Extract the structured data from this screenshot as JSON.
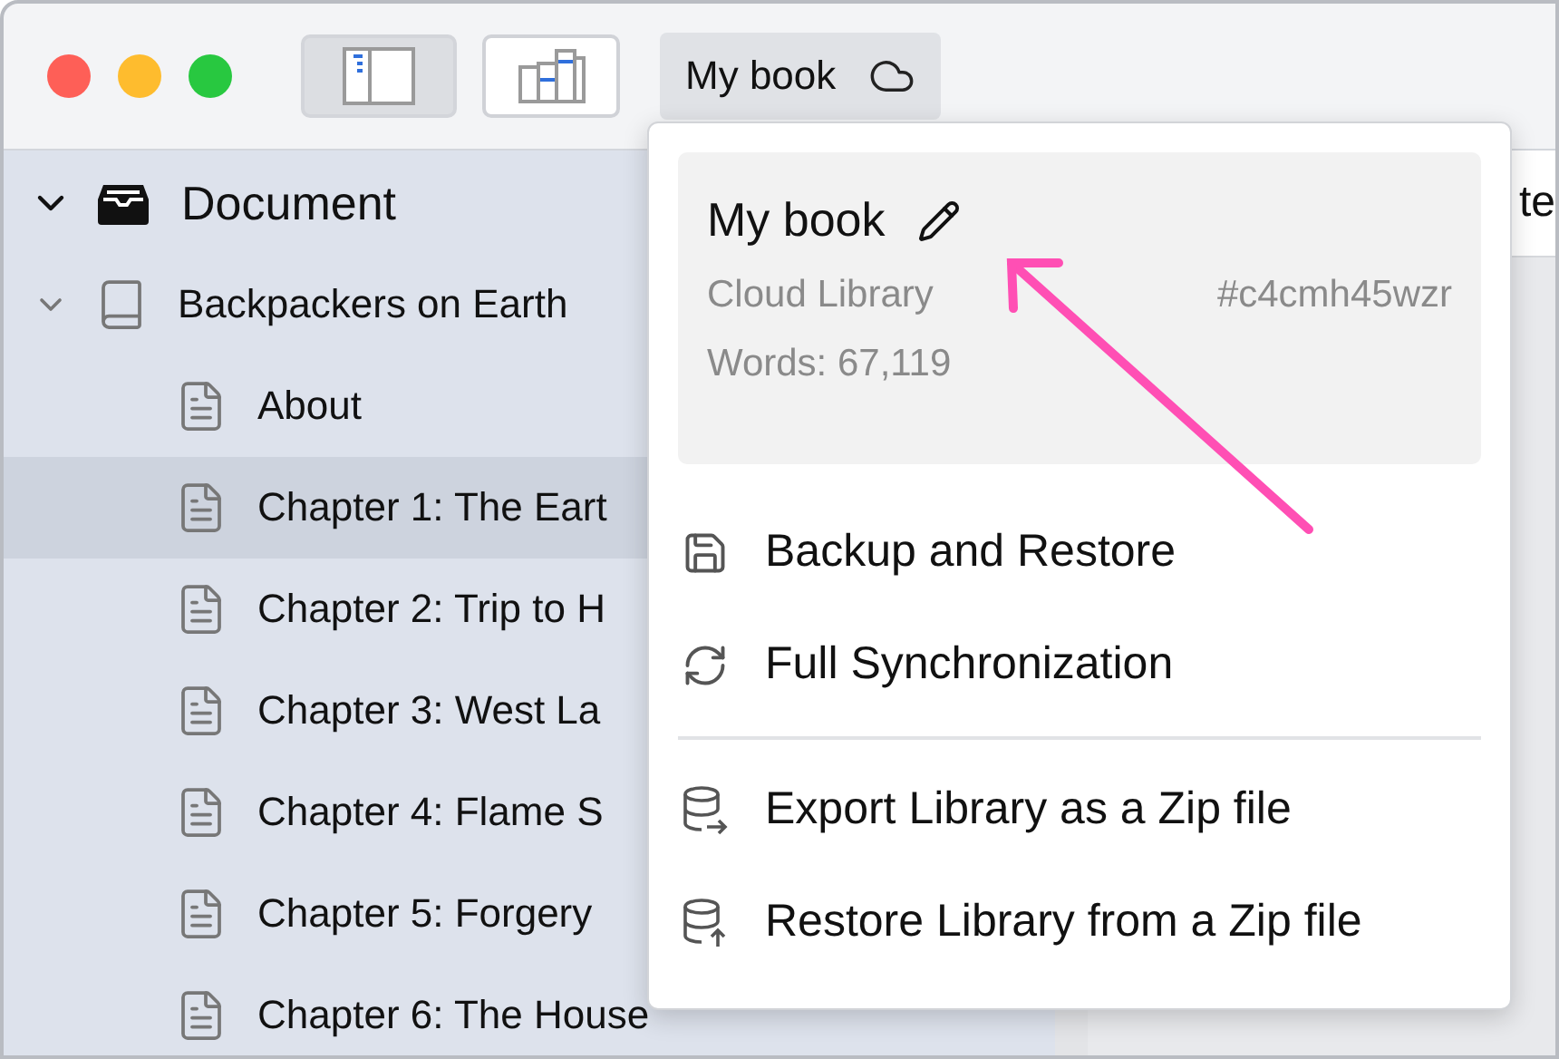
{
  "window_controls": [
    {
      "color": "#fe5f57"
    },
    {
      "color": "#febc2e"
    },
    {
      "color": "#28c840"
    }
  ],
  "toolbar": {
    "sidebar_toggle": {
      "selected": true
    },
    "statistics": {
      "selected": false
    },
    "library_button": {
      "label": "My book",
      "expanded": true
    }
  },
  "sidebar": {
    "items": [
      {
        "kind": "root",
        "label": "Document",
        "expanded": true,
        "children": [
          {
            "kind": "book",
            "label": "Backpackers on Earth",
            "expanded": true,
            "children": [
              {
                "kind": "doc",
                "label": "About",
                "selected": false
              },
              {
                "kind": "doc",
                "label": "Chapter 1: The Eart",
                "selected": true
              },
              {
                "kind": "doc",
                "label": "Chapter 2: Trip to H",
                "selected": false
              },
              {
                "kind": "doc",
                "label": "Chapter 3: West La",
                "selected": false
              },
              {
                "kind": "doc",
                "label": "Chapter 4: Flame S",
                "selected": false
              },
              {
                "kind": "doc",
                "label": "Chapter 5: Forgery",
                "selected": false
              },
              {
                "kind": "doc",
                "label": "Chapter 6: The House",
                "selected": false
              }
            ]
          }
        ]
      }
    ]
  },
  "content": {
    "tab_label": "te"
  },
  "library_menu": {
    "name": "My book",
    "location": "Cloud Library",
    "id": "#c4cmh45wzr",
    "words": "Words: 67,119",
    "items": [
      {
        "kind": "backup",
        "label": "Backup and Restore"
      },
      {
        "kind": "sync",
        "label": "Full Synchronization"
      },
      {
        "kind": "divider"
      },
      {
        "kind": "export",
        "label": "Export Library as a Zip file"
      },
      {
        "kind": "import",
        "label": "Restore Library from a Zip file"
      }
    ]
  }
}
